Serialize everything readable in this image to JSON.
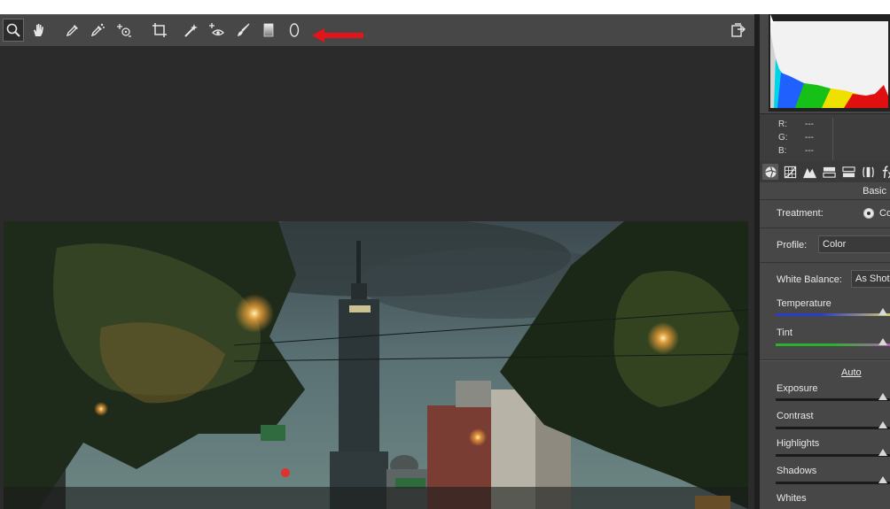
{
  "toolbar": {
    "tools": [
      {
        "name": "zoom-tool",
        "icon": "magnifier-icon",
        "active": true
      },
      {
        "name": "hand-tool",
        "icon": "hand-icon"
      },
      {
        "name": "white-balance-tool",
        "icon": "eyedropper-icon"
      },
      {
        "name": "color-sampler-tool",
        "icon": "color-sampler-icon"
      },
      {
        "name": "targeted-adjustment-tool",
        "icon": "targeted-adjust-icon"
      },
      {
        "name": "crop-tool",
        "icon": "crop-icon"
      },
      {
        "name": "straighten-tool",
        "icon": "straighten-icon"
      },
      {
        "name": "red-eye-tool",
        "icon": "red-eye-icon"
      },
      {
        "name": "adjustment-brush-tool",
        "icon": "brush-icon"
      },
      {
        "name": "graduated-filter-tool",
        "icon": "gradient-icon"
      },
      {
        "name": "radial-filter-tool",
        "icon": "ellipse-icon"
      }
    ],
    "export_icon": "export-icon"
  },
  "annotation_color": "#e3141a",
  "readout": {
    "r_label": "R:",
    "r_value": "---",
    "g_label": "G:",
    "g_value": "---",
    "b_label": "B:",
    "b_value": "---"
  },
  "panel": {
    "section_title": "Basic",
    "treatment_label": "Treatment:",
    "treatment_value": "Co",
    "profile_label": "Profile:",
    "profile_value": "Color",
    "wb_label": "White Balance:",
    "wb_value": "As Shot",
    "auto_label": "Auto",
    "sliders": [
      {
        "label": "Temperature",
        "value": 0.94,
        "track": "temperature"
      },
      {
        "label": "Tint",
        "value": 0.94,
        "track": "tint"
      },
      {
        "label": "Exposure",
        "value": 0.94
      },
      {
        "label": "Contrast",
        "value": 0.94
      },
      {
        "label": "Highlights",
        "value": 0.94
      },
      {
        "label": "Shadows",
        "value": 0.94
      },
      {
        "label": "Whites",
        "value": null
      }
    ]
  }
}
